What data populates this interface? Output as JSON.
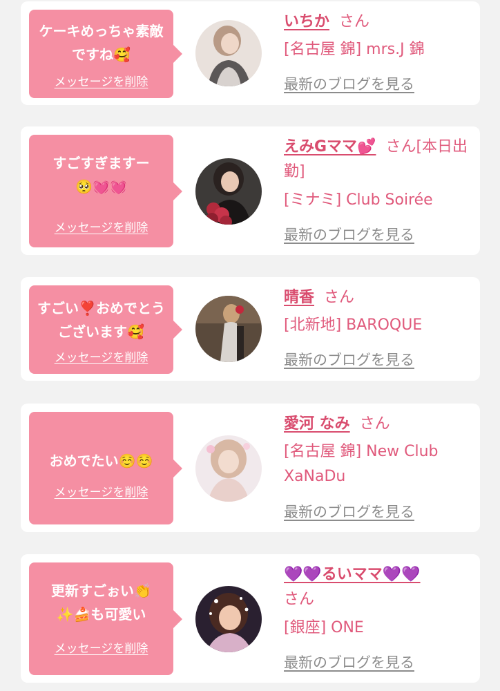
{
  "cards": [
    {
      "message": "ケーキめっちゃ素敵ですね🥰",
      "delete_label": "メッセージを削除",
      "name": "いちか",
      "honorific": "さん",
      "shop": "[名古屋 錦] mrs.J 錦",
      "blog_label": "最新のブログを見る"
    },
    {
      "message": "すごすぎますー🥺💓💓",
      "delete_label": "メッセージを削除",
      "name": "えみGママ💕",
      "honorific": "さん[本日出勤]",
      "shop": "[ミナミ] Club Soirée",
      "blog_label": "最新のブログを見る"
    },
    {
      "message": "すごい❣️おめでとうございます🥰",
      "delete_label": "メッセージを削除",
      "name": "晴香",
      "honorific": "さん",
      "shop": "[北新地] BAROQUE",
      "blog_label": "最新のブログを見る"
    },
    {
      "message": "おめでたい☺️☺️",
      "delete_label": "メッセージを削除",
      "name": "愛河 なみ",
      "honorific": "さん",
      "shop": "[名古屋 錦] New Club XaNaDu",
      "blog_label": "最新のブログを見る"
    },
    {
      "message": "更新すごぉい👏✨🍰も可愛い",
      "delete_label": "メッセージを削除",
      "name": "💜💜るいママ💜💜",
      "honorific": "さん",
      "shop": "[銀座] ONE",
      "blog_label": "最新のブログを見る"
    }
  ],
  "colors": {
    "background": "#f2f2f2",
    "card": "#ffffff",
    "bubble": "#f58fa3",
    "name": "#d94c6e",
    "shop": "#e05a7c",
    "blog_link": "#8c8c8c"
  }
}
